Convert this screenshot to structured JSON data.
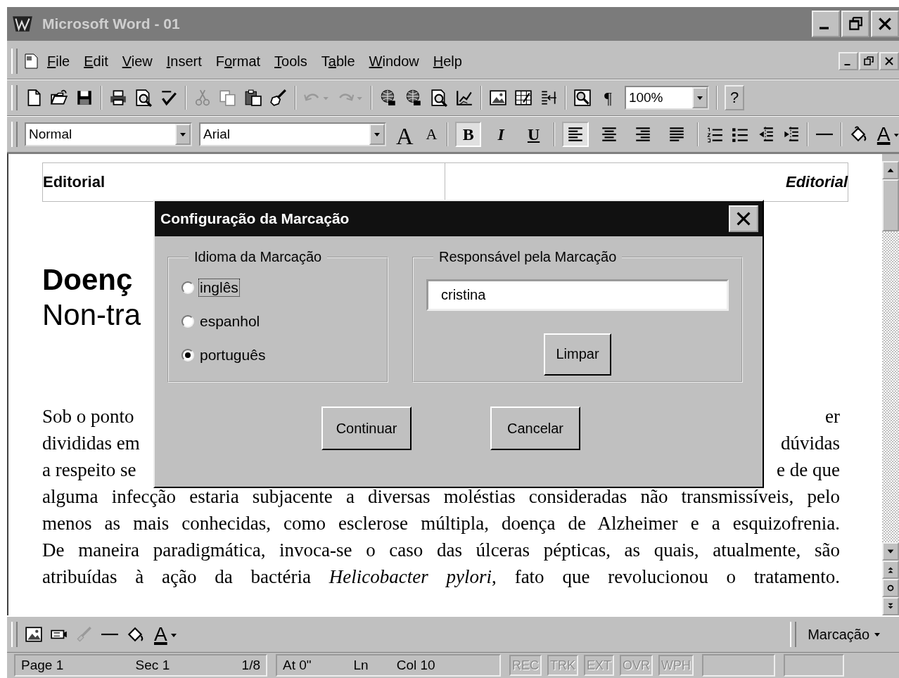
{
  "window": {
    "title": "Microsoft Word - 01"
  },
  "menu_bar": {
    "items": [
      {
        "key": "F",
        "after": "ile"
      },
      {
        "key": "E",
        "after": "dit"
      },
      {
        "key": "V",
        "after": "iew"
      },
      {
        "key": "I",
        "after": "nsert"
      },
      {
        "before": "F",
        "key": "o",
        "after": "rmat"
      },
      {
        "key": "T",
        "after": "ools"
      },
      {
        "before": "T",
        "key": "a",
        "after": "ble"
      },
      {
        "key": "W",
        "after": "indow"
      },
      {
        "key": "H",
        "after": "elp"
      }
    ]
  },
  "standard_toolbar": {
    "pilcrow": "¶",
    "zoom": "100%",
    "help": "?"
  },
  "formatting_toolbar": {
    "style": "Normal",
    "font": "Arial",
    "grow_font": "A",
    "shrink_font": "A",
    "styles": [
      {
        "kind": "bold",
        "label": "B",
        "selected": true
      },
      {
        "kind": "italic",
        "label": "I",
        "selected": false
      },
      {
        "kind": "underline",
        "label": "U",
        "selected": false
      }
    ],
    "alignments": [
      {
        "kind": "left",
        "selected": true
      },
      {
        "kind": "center",
        "selected": false
      },
      {
        "kind": "right",
        "selected": false
      },
      {
        "kind": "justify",
        "selected": false
      }
    ],
    "font_color": "A"
  },
  "document": {
    "header": {
      "left": "Editorial",
      "right": "Editorial"
    },
    "title_lines": [
      {
        "kind": "bold",
        "text": "Doenç"
      },
      {
        "kind": "normal",
        "text": "Non-tra"
      }
    ],
    "paragraph_lines": [
      {
        "left": "Sob o ponto",
        "right": "er"
      },
      {
        "left": "divididas em",
        "right": "dúvidas"
      },
      {
        "left": "a respeito se",
        "right": "e de que"
      },
      {
        "text": "alguma infecção estaria subjacente a diversas moléstias consideradas não transmissíveis, pelo"
      },
      {
        "text": "menos as mais conhecidas, como esclerose múltipla, doença de Alzheimer e a esquizofrenia."
      },
      {
        "text": "De maneira paradigmática, invoca-se o caso das úlceras pépticas, as quais, atualmente, são"
      },
      {
        "text": "atribuídas à ação da bactéria *Helicobacter pylori*, fato que revolucionou o tratamento."
      }
    ]
  },
  "dialog": {
    "title": "Configuração da Marcação",
    "language_group": {
      "legend": "Idioma da Marcação",
      "options": [
        {
          "label": "inglês",
          "selected": false,
          "focused": true
        },
        {
          "label": "espanhol",
          "selected": false,
          "focused": false
        },
        {
          "label": "português",
          "selected": true,
          "focused": false
        }
      ]
    },
    "responsible_group": {
      "legend": "Responsável pela Marcação",
      "value": "cristina",
      "button": "Limpar"
    },
    "buttons": [
      "Continuar",
      "Cancelar"
    ]
  },
  "drawing_toolbar": {
    "font_color": "A",
    "menu": "Marcação"
  },
  "status_bar": {
    "panels": [
      [
        "Page 1",
        "Sec 1",
        "1/8"
      ],
      [
        "At 0\"",
        "Ln",
        "Col 10"
      ]
    ],
    "indicators": [
      {
        "label": "REC",
        "active": false
      },
      {
        "label": "TRK",
        "active": false
      },
      {
        "label": "EXT",
        "active": false
      },
      {
        "label": "OVR",
        "active": false
      },
      {
        "label": "WPH",
        "active": false
      }
    ]
  }
}
